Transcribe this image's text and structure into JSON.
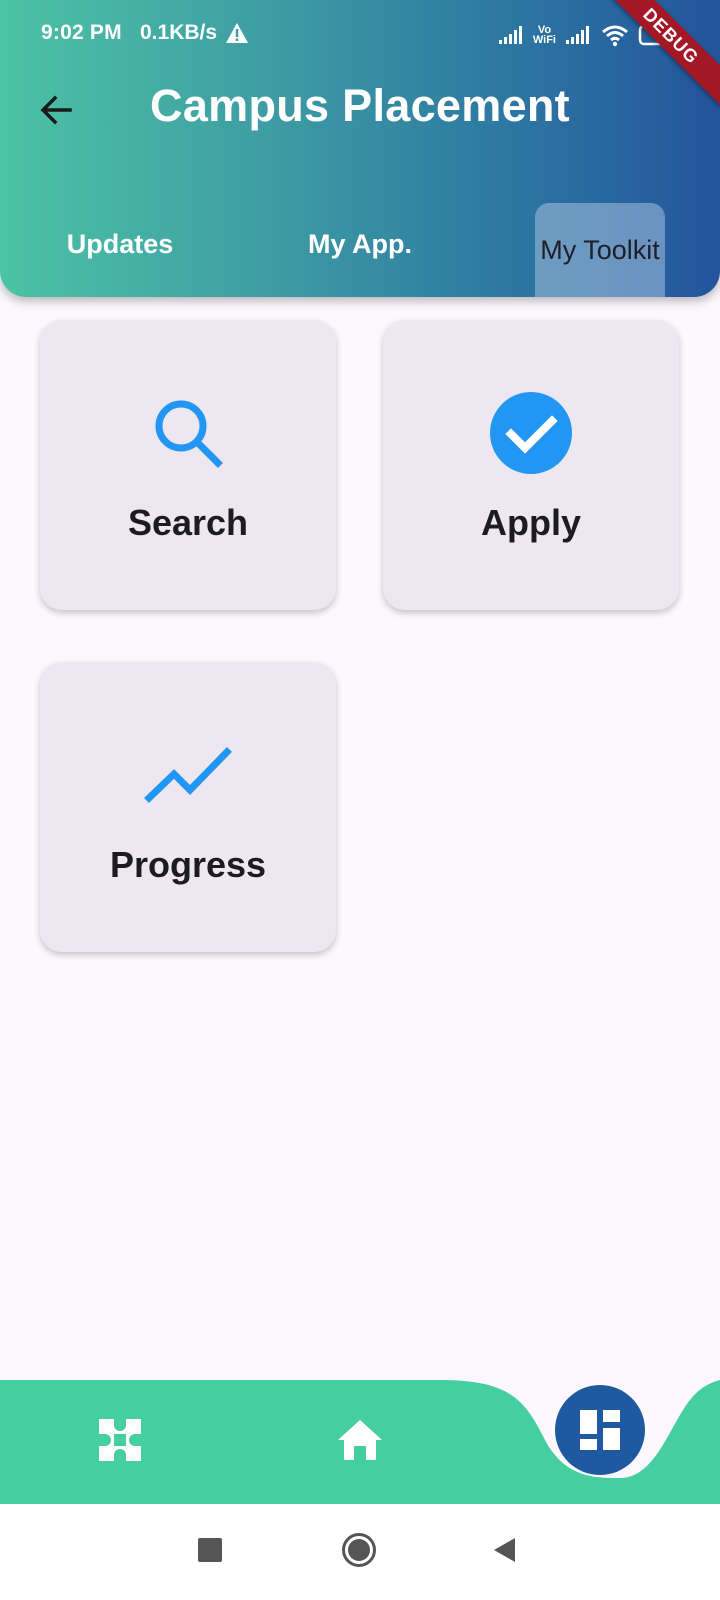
{
  "status_bar": {
    "time": "9:02 PM",
    "net_speed": "0.1KB/s",
    "vowifi_top": "Vo",
    "vowifi_bottom": "WiFi"
  },
  "debug_banner": "DEBUG",
  "header": {
    "title": "Campus Placement",
    "tabs": [
      {
        "label": "Updates",
        "selected": false
      },
      {
        "label": "My App.",
        "selected": false
      },
      {
        "label": "My Toolkit",
        "selected": true
      }
    ]
  },
  "toolkit": {
    "cards": [
      {
        "label": "Search",
        "icon": "search-icon"
      },
      {
        "label": "Apply",
        "icon": "check-circle-icon"
      },
      {
        "label": "Progress",
        "icon": "trending-up-icon"
      }
    ]
  },
  "bottom_nav": {
    "items": [
      {
        "icon": "puzzle-icon"
      },
      {
        "icon": "home-icon"
      },
      {
        "icon": "dashboard-icon",
        "active": true
      }
    ]
  },
  "colors": {
    "header_gradient_start": "#4cc3a4",
    "header_gradient_end": "#23549c",
    "accent_blue": "#2196f3",
    "nav_green": "#45cfa0",
    "fab_blue": "#1f5aa0",
    "card_bg": "#ede8f0"
  }
}
